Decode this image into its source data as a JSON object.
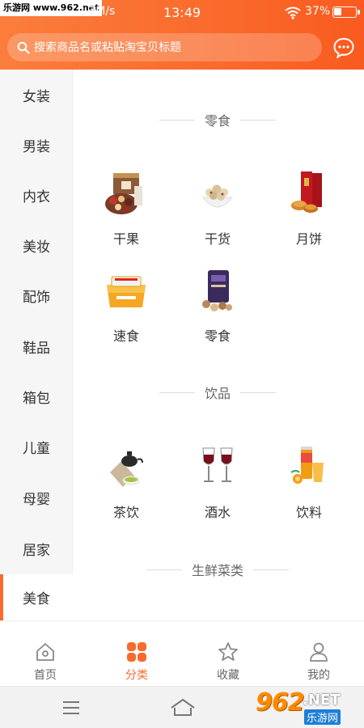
{
  "status_bar": {
    "watermark": "乐游网 www.962.net",
    "speed": "2.3M/s",
    "time": "13:49",
    "battery": "37%"
  },
  "search": {
    "placeholder": "搜索商品名或粘贴淘宝贝标题"
  },
  "colors": {
    "brand_orange": "#fa6a2c",
    "sidebar_bg": "#f6f6f6"
  },
  "sidebar": {
    "items": [
      {
        "label": "女装"
      },
      {
        "label": "男装"
      },
      {
        "label": "内衣"
      },
      {
        "label": "美妆"
      },
      {
        "label": "配饰"
      },
      {
        "label": "鞋品"
      },
      {
        "label": "箱包"
      },
      {
        "label": "儿童"
      },
      {
        "label": "母婴"
      },
      {
        "label": "居家"
      },
      {
        "label": "美食"
      }
    ],
    "selected": "美食"
  },
  "sections": [
    {
      "title": "零食",
      "items": [
        {
          "label": "干果",
          "icon": "dried-fruit-gift-box-icon"
        },
        {
          "label": "干货",
          "icon": "nuts-bowl-icon"
        },
        {
          "label": "月饼",
          "icon": "mooncake-box-icon"
        },
        {
          "label": "速食",
          "icon": "instant-noodle-bowl-icon"
        },
        {
          "label": "零食",
          "icon": "snack-bag-icon"
        }
      ]
    },
    {
      "title": "饮品",
      "items": [
        {
          "label": "茶饮",
          "icon": "tea-set-icon"
        },
        {
          "label": "酒水",
          "icon": "wine-glasses-icon"
        },
        {
          "label": "饮料",
          "icon": "juice-drink-icon"
        }
      ]
    },
    {
      "title": "生鲜菜类",
      "items": []
    }
  ],
  "tabbar": {
    "items": [
      {
        "label": "首页",
        "icon": "home-icon"
      },
      {
        "label": "分类",
        "icon": "category-grid-icon"
      },
      {
        "label": "收藏",
        "icon": "star-icon"
      },
      {
        "label": "我的",
        "icon": "user-icon"
      }
    ],
    "active": "分类"
  },
  "branding": {
    "logo_number": "962",
    "logo_suffix": ".NET",
    "logo_cn": "乐游网"
  }
}
